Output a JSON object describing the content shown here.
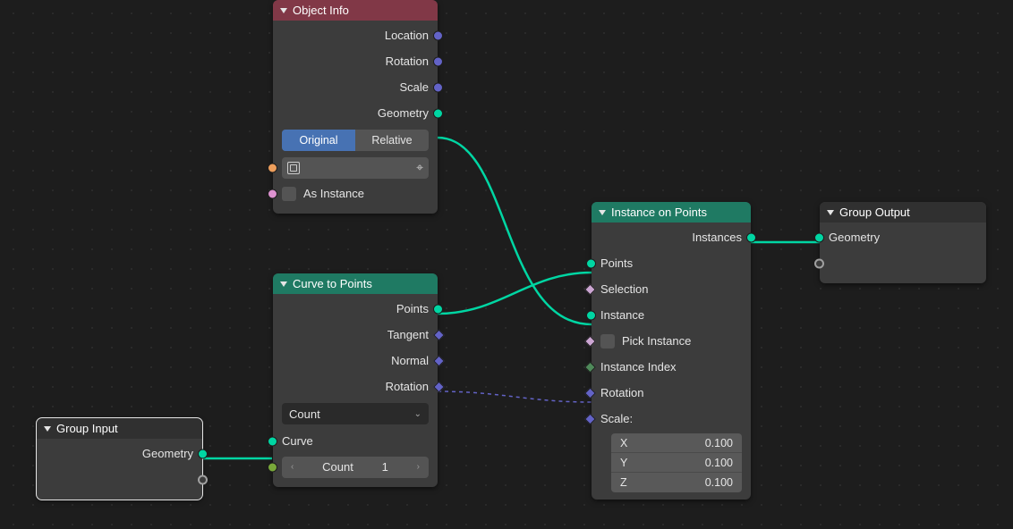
{
  "nodes": {
    "object_info": {
      "title": "Object Info",
      "outputs": {
        "location": "Location",
        "rotation": "Rotation",
        "scale": "Scale",
        "geometry": "Geometry"
      },
      "mode": {
        "original": "Original",
        "relative": "Relative",
        "active": "original"
      },
      "object_field": "",
      "as_instance": "As Instance"
    },
    "curve_to_points": {
      "title": "Curve to Points",
      "outputs": {
        "points": "Points",
        "tangent": "Tangent",
        "normal": "Normal",
        "rotation": "Rotation"
      },
      "mode_label": "Count",
      "inputs": {
        "curve": "Curve"
      },
      "count_label": "Count",
      "count_value": "1"
    },
    "group_input": {
      "title": "Group Input",
      "outputs": {
        "geometry": "Geometry"
      }
    },
    "instance_on_points": {
      "title": "Instance on Points",
      "outputs": {
        "instances": "Instances"
      },
      "inputs": {
        "points": "Points",
        "selection": "Selection",
        "instance": "Instance",
        "pick_instance": "Pick Instance",
        "instance_index": "Instance Index",
        "rotation": "Rotation",
        "scale": "Scale:"
      },
      "scale": {
        "x_label": "X",
        "x": "0.100",
        "y_label": "Y",
        "y": "0.100",
        "z_label": "Z",
        "z": "0.100"
      }
    },
    "group_output": {
      "title": "Group Output",
      "inputs": {
        "geometry": "Geometry"
      }
    }
  }
}
